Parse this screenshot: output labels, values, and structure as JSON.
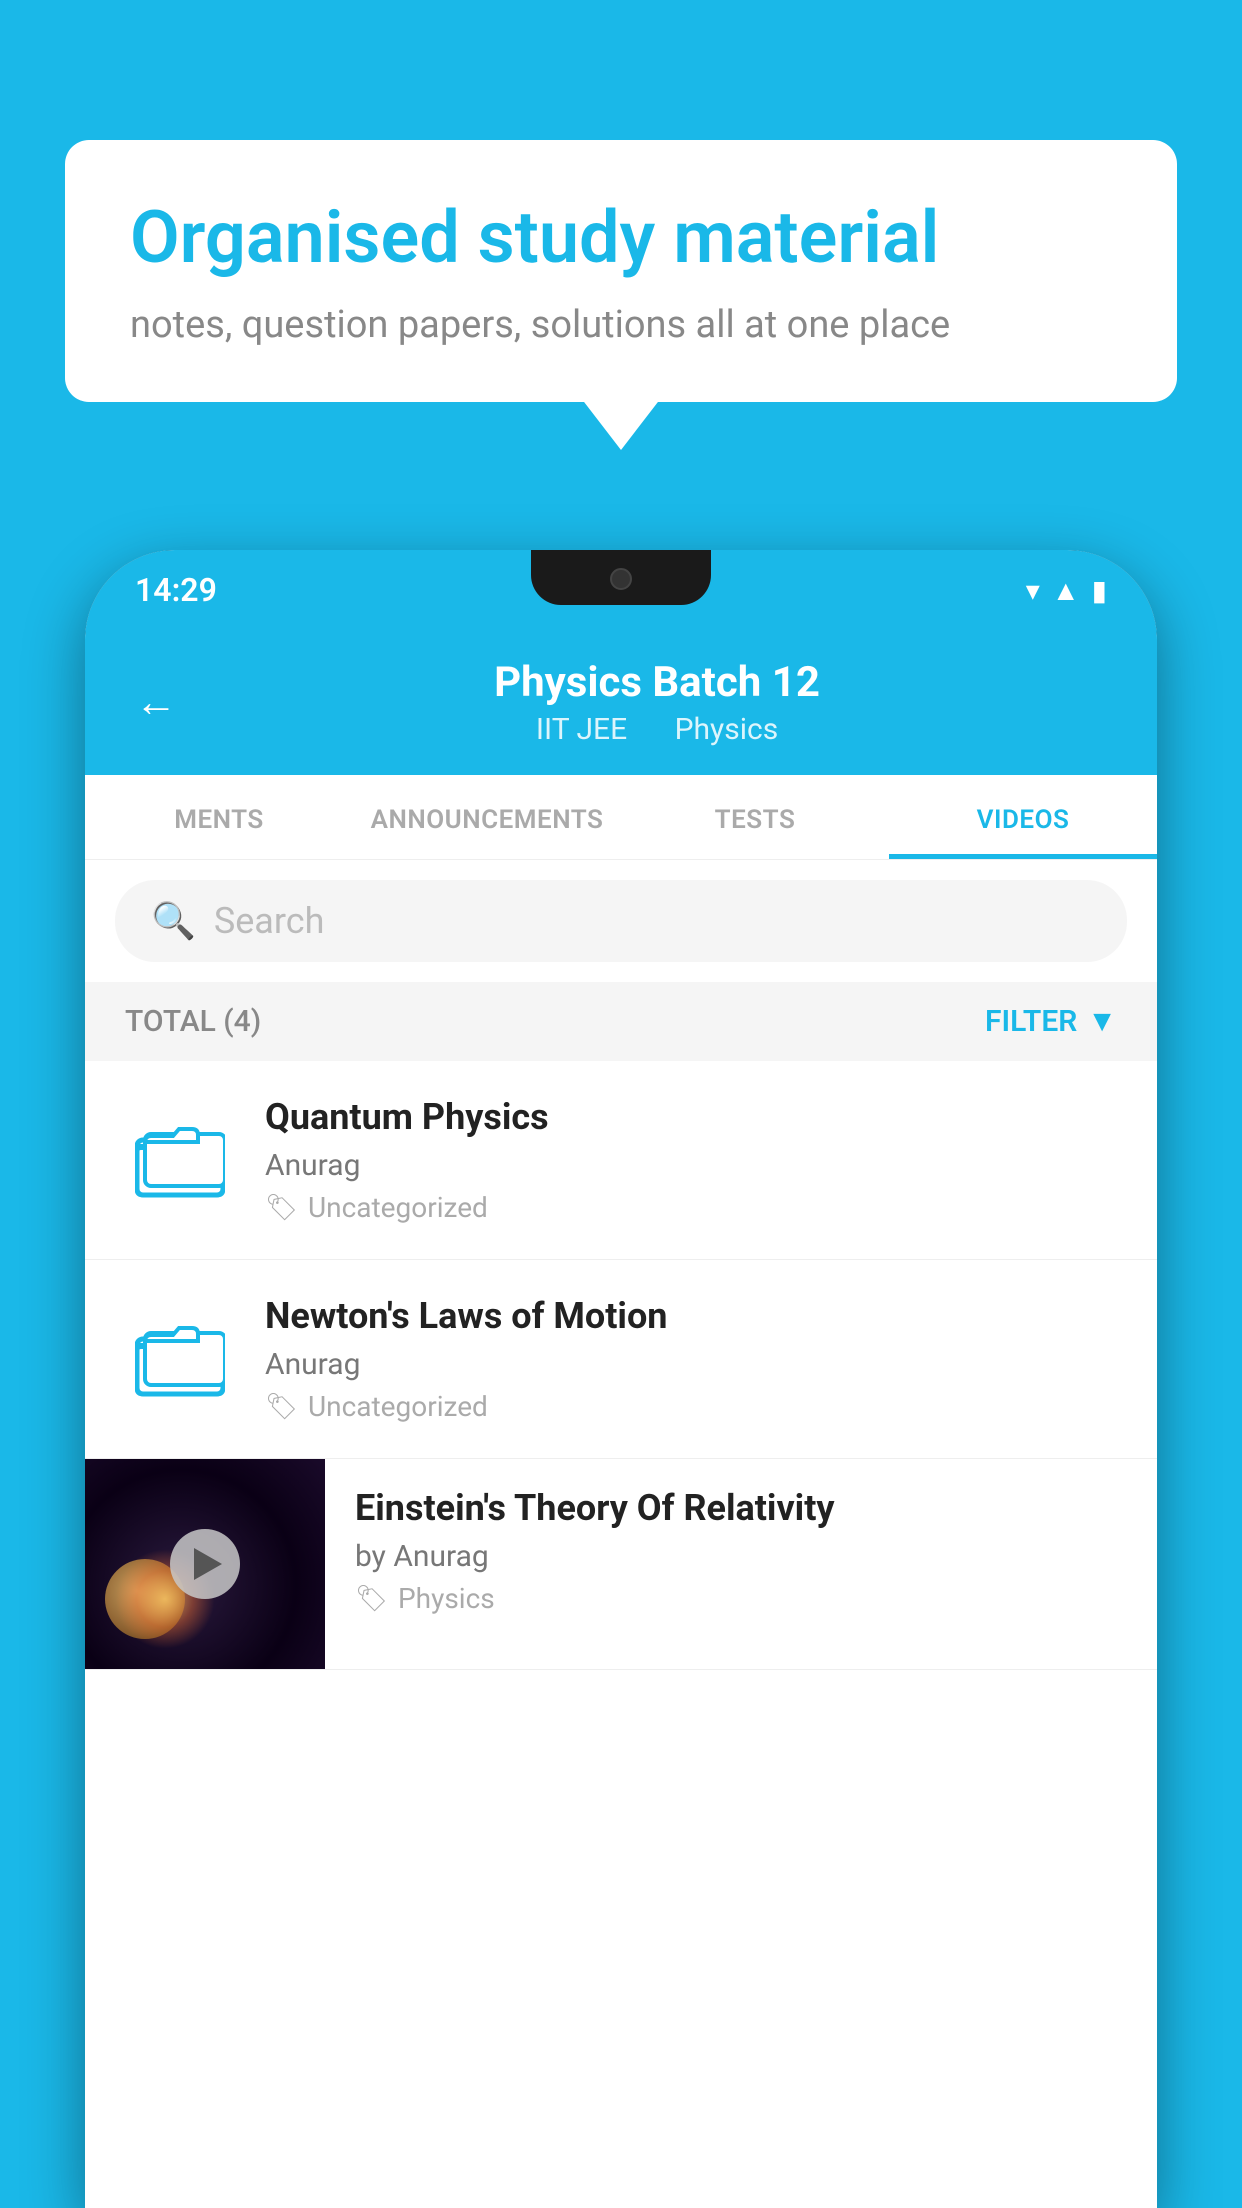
{
  "background": {
    "color": "#1ab8e8"
  },
  "bubble": {
    "title": "Organised study material",
    "subtitle": "notes, question papers, solutions all at one place"
  },
  "phone": {
    "status_bar": {
      "time": "14:29"
    },
    "header": {
      "title": "Physics Batch 12",
      "subtitle_part1": "IIT JEE",
      "subtitle_part2": "Physics",
      "back_label": "←"
    },
    "tabs": [
      {
        "label": "MENTS",
        "active": false
      },
      {
        "label": "ANNOUNCEMENTS",
        "active": false
      },
      {
        "label": "TESTS",
        "active": false
      },
      {
        "label": "VIDEOS",
        "active": true
      }
    ],
    "search": {
      "placeholder": "Search"
    },
    "filter": {
      "total_label": "TOTAL (4)",
      "filter_label": "FILTER"
    },
    "videos": [
      {
        "title": "Quantum Physics",
        "author": "Anurag",
        "tag": "Uncategorized",
        "type": "folder"
      },
      {
        "title": "Newton's Laws of Motion",
        "author": "Anurag",
        "tag": "Uncategorized",
        "type": "folder"
      },
      {
        "title": "Einstein's Theory Of Relativity",
        "author": "by Anurag",
        "tag": "Physics",
        "type": "video"
      }
    ]
  }
}
